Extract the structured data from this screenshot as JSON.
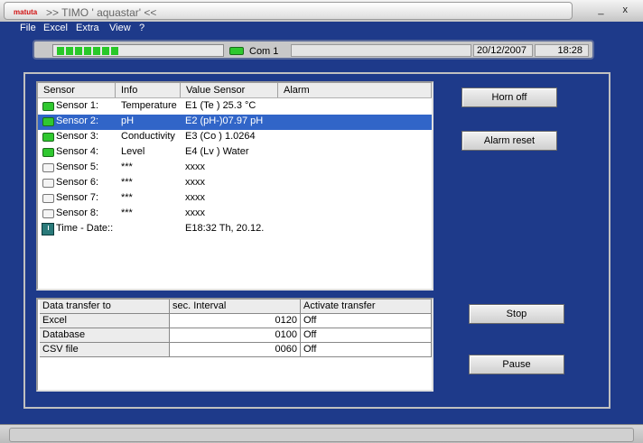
{
  "window": {
    "logo_text": "matuta",
    "title": ">> TIMO ' aquastar' <<",
    "controls": "_ x"
  },
  "menu": [
    "File",
    "Excel",
    "Extra",
    "View",
    "?"
  ],
  "status": {
    "progress_segments": 7,
    "com_label": "Com  1",
    "date": "20/12/2007",
    "time": "18:28"
  },
  "sensors": {
    "columns": [
      "Sensor",
      "Info",
      "Value Sensor",
      "Alarm"
    ],
    "rows": [
      {
        "sensor": "Sensor 1:",
        "info": "Temperature",
        "value": "E1 (Te ) 25.3  °C",
        "alarm": "",
        "led": "on"
      },
      {
        "sensor": "Sensor 2:",
        "info": "pH",
        "value": "E2 (pH-)07.97  pH",
        "alarm": "",
        "led": "on"
      },
      {
        "sensor": "Sensor 3:",
        "info": "Conductivity",
        "value": "E3 (Co )  1.0264",
        "alarm": "",
        "led": "on"
      },
      {
        "sensor": "Sensor 4:",
        "info": "Level",
        "value": "E4 (Lv ) Water",
        "alarm": "",
        "led": "on"
      },
      {
        "sensor": "Sensor 5:",
        "info": "***",
        "value": "xxxx",
        "alarm": "",
        "led": "off"
      },
      {
        "sensor": "Sensor 6:",
        "info": "***",
        "value": "xxxx",
        "alarm": "",
        "led": "off"
      },
      {
        "sensor": "Sensor 7:",
        "info": "***",
        "value": "xxxx",
        "alarm": "",
        "led": "off"
      },
      {
        "sensor": "Sensor 8:",
        "info": "***",
        "value": "xxxx",
        "alarm": "",
        "led": "off"
      },
      {
        "sensor": "Time - Date::",
        "info": "",
        "value": "E18:32    Th, 20.12.",
        "alarm": "",
        "led": "clock"
      }
    ],
    "selected_row": "Sensor 2:"
  },
  "transfer": {
    "columns": [
      "Data transfer to",
      "sec. Interval",
      "Activate transfer"
    ],
    "rows": [
      {
        "target": "Excel",
        "interval": "0120",
        "active": "Off"
      },
      {
        "target": "Database",
        "interval": "0100",
        "active": "Off"
      },
      {
        "target": "CSV file",
        "interval": "0060",
        "active": "Off"
      }
    ]
  },
  "buttons": {
    "horn_off": "Horn off",
    "alarm_reset": "Alarm reset",
    "stop": "Stop",
    "pause": "Pause"
  },
  "colors": {
    "background": "#1e3a8a",
    "selection": "#3165c8",
    "led_on": "#30c830"
  }
}
